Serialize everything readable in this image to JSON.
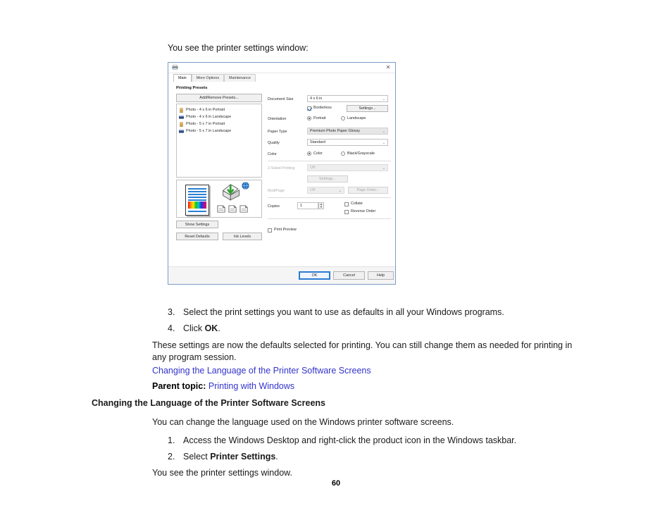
{
  "document": {
    "intro_line": "You see the printer settings window:",
    "steps": [
      {
        "num": "3.",
        "text": "Select the print settings you want to use as defaults in all your Windows programs."
      },
      {
        "num": "4.",
        "text_before": "Click ",
        "bold": "OK",
        "text_after": "."
      }
    ],
    "paragraph": "These settings are now the defaults selected for printing. You can still change them as needed for printing in any program session.",
    "link_1": "Changing the Language of the Printer Software Screens",
    "parent_label": "Parent topic:",
    "parent_link": "Printing with Windows",
    "section_heading": "Changing the Language of the Printer Software Screens",
    "section_intro": "You can change the language used on the Windows printer software screens.",
    "steps_2": [
      {
        "num": "1.",
        "text": "Access the Windows Desktop and right-click the product icon in the Windows taskbar."
      },
      {
        "num": "2.",
        "text_before": "Select ",
        "bold": "Printer Settings",
        "text_after": "."
      }
    ],
    "closing_line": "You see the printer settings window.",
    "page_number": "60",
    "link_color": "#3333cc"
  },
  "dialog": {
    "close_label": "✕",
    "tabs": [
      {
        "label": "Main",
        "active": true
      },
      {
        "label": "More Options",
        "active": false
      },
      {
        "label": "Maintenance",
        "active": false
      }
    ],
    "presets": {
      "heading": "Printing Presets",
      "add_remove_button": "Add/Remove Presets...",
      "items": [
        {
          "label": "Photo - 4 x 6 in Portrait",
          "orientation": "portrait"
        },
        {
          "label": "Photo - 4 x 6 in Landscape",
          "orientation": "landscape"
        },
        {
          "label": "Photo - 5 x 7 in Portrait",
          "orientation": "portrait"
        },
        {
          "label": "Photo - 5 x 7 in Landscape",
          "orientation": "landscape"
        }
      ]
    },
    "left_buttons": {
      "show_settings": "Show Settings",
      "reset_defaults": "Reset Defaults",
      "ink_levels": "Ink Levels"
    },
    "settings": {
      "document_size_label": "Document Size",
      "document_size_value": "4 x 6 in",
      "borderless_label": "Borderless",
      "borderless_checked": true,
      "borderless_settings_button": "Settings...",
      "orientation_label": "Orientation",
      "orientation_portrait": "Portrait",
      "orientation_landscape": "Landscape",
      "orientation_value": "Portrait",
      "paper_type_label": "Paper Type",
      "paper_type_value": "Premium Photo Paper Glossy",
      "quality_label": "Quality",
      "quality_value": "Standard",
      "color_label": "Color",
      "color_option_color": "Color",
      "color_option_gray": "Black/Grayscale",
      "color_value": "Color",
      "two_sided_label": "2-Sided Printing",
      "two_sided_value": "Off",
      "two_sided_settings_button": "Settings...",
      "multipage_label": "MultiPage",
      "multipage_value": "Off",
      "page_order_button": "Page Order...",
      "copies_label": "Copies",
      "copies_value": "1",
      "collate_label": "Collate",
      "collate_checked": false,
      "reverse_order_label": "Reverse Order",
      "reverse_order_checked": false,
      "print_preview_label": "Print Preview",
      "print_preview_checked": false
    },
    "footer_buttons": {
      "ok": "OK",
      "cancel": "Cancel",
      "help": "Help"
    }
  }
}
